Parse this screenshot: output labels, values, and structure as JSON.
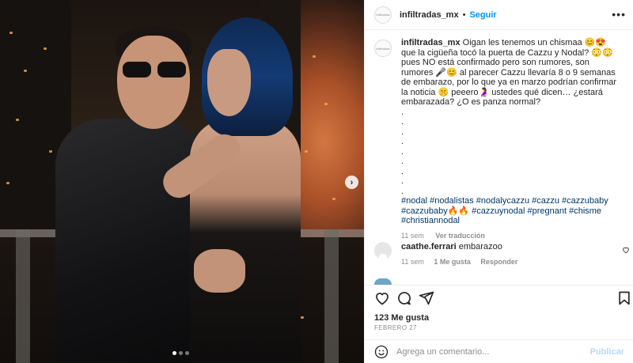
{
  "header": {
    "username": "infiltradas_mx",
    "separator": "•",
    "follow_label": "Seguir",
    "more_label": "•••",
    "avatar_text": "infiltradas"
  },
  "caption": {
    "username": "infiltradas_mx",
    "text": "Oigan les tenemos un chismaa 😊😍 que la cigüeña tocó la puerta de Cazzu y Nodal? 😳😳 pues NO está confirmado pero son rumores, son rumores 🎤😊 al parecer Cazzu llevaría 8 o 9 semanas de embarazo, por lo que ya en marzo podrían confirmar la noticia 🤫 peeero🤰 ustedes qué dicen… ¿estará embarazada? ¿O es panza normal?",
    "dots": [
      ".",
      ".",
      ".",
      ".",
      ".",
      ".",
      ".",
      ".",
      "."
    ],
    "hashtags": "#nodal #nodalistas #nodalycazzu #cazzu #cazzubaby #cazzubaby🔥🔥 #cazzuynodal #pregnant #chisme #christiannodal",
    "age": "11 sem",
    "translation": "Ver traducción"
  },
  "comment": {
    "username": "caathe.ferrari",
    "text": "embarazoo",
    "age": "11 sem",
    "likes": "1 Me gusta",
    "reply": "Responder"
  },
  "post": {
    "likes": "123 Me gusta",
    "date": "FEBRERO 27"
  },
  "add_comment": {
    "placeholder": "Agrega un comentario...",
    "publish": "Publicar"
  },
  "carousel": {
    "next_icon": "›",
    "total_slides": 3,
    "active_slide": 1
  },
  "colors": {
    "link_blue": "#0095f6",
    "hashtag": "#00376b",
    "muted": "#8e8e8e",
    "publish_disabled": "#b3dbff"
  }
}
